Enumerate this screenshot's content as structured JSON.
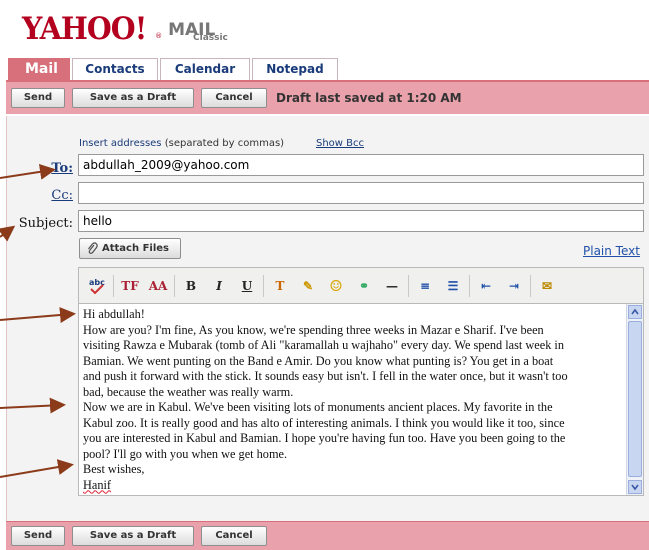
{
  "header": {
    "brand": "YAHOO!",
    "product": "MAIL",
    "edition": "Classic"
  },
  "tabs": [
    {
      "label": "Mail",
      "active": true
    },
    {
      "label": "Contacts",
      "active": false
    },
    {
      "label": "Calendar",
      "active": false
    },
    {
      "label": "Notepad",
      "active": false
    }
  ],
  "toolbar": {
    "send_label": "Send",
    "draft_label": "Save as a Draft",
    "cancel_label": "Cancel",
    "draft_status": "Draft last saved at 1:20 AM"
  },
  "compose": {
    "insert_hint": "Insert addresses",
    "insert_hint_note": "(separated by commas)",
    "show_bcc": "Show Bcc",
    "to_label": "To:",
    "to_value": "abdullah_2009@yahoo.com",
    "cc_label": "Cc:",
    "cc_value": "",
    "subject_label": "Subject:",
    "subject_value": "hello",
    "attach_label": "Attach Files",
    "plain_text_label": "Plain Text"
  },
  "editor": {
    "toolbar_buttons": [
      {
        "name": "spellcheck-icon",
        "glyph": "abc"
      },
      {
        "name": "font-face-icon",
        "glyph": "TF"
      },
      {
        "name": "font-size-icon",
        "glyph": "AA"
      },
      {
        "name": "bold-icon",
        "glyph": "B"
      },
      {
        "name": "italic-icon",
        "glyph": "I"
      },
      {
        "name": "underline-icon",
        "glyph": "U"
      },
      {
        "name": "text-color-icon",
        "glyph": "T"
      },
      {
        "name": "highlight-icon",
        "glyph": "✎"
      },
      {
        "name": "emoticon-icon",
        "glyph": "☺"
      },
      {
        "name": "insert-link-icon",
        "glyph": "⚭"
      },
      {
        "name": "horizontal-rule-icon",
        "glyph": "—"
      },
      {
        "name": "numbered-list-icon",
        "glyph": "≡"
      },
      {
        "name": "bulleted-list-icon",
        "glyph": "☰"
      },
      {
        "name": "outdent-icon",
        "glyph": "⇤"
      },
      {
        "name": "indent-icon",
        "glyph": "⇥"
      },
      {
        "name": "stationery-icon",
        "glyph": "✉"
      }
    ],
    "body_lines": [
      "Hi abdullah!",
      "How are you? I'm fine, As you know, we're spending three weeks in Mazar e Sharif. I've been",
      "visiting Rawza e Mubarak (tomb of Ali \"karamallah u wajhaho\" every day. We spend last week in",
      "Bamian. We went punting on the Band e Amir. Do you know what punting is? You get in a boat",
      "and push it forward with the stick. It sounds easy but isn't. I fell in the water once, but it wasn't too",
      "bad, because the weather was really warm.",
      "Now we are in Kabul. We've been visiting lots of monuments ancient places. My favorite in the",
      "Kabul zoo. It is really good and has alto of interesting animals. I think you would like it too, since",
      "you are interested in Kabul and Bamian. I hope you're having fun too. Have you been going to the",
      "pool? I'll go with you when we get home.",
      "Best wishes,",
      "Hanif"
    ]
  },
  "colors": {
    "brand_red": "#b4001f",
    "toolbar_pink": "#e9a2ab",
    "active_tab": "#d7707b",
    "link_blue": "#1a3b7a",
    "arrow_brown": "#8b3a1a"
  }
}
